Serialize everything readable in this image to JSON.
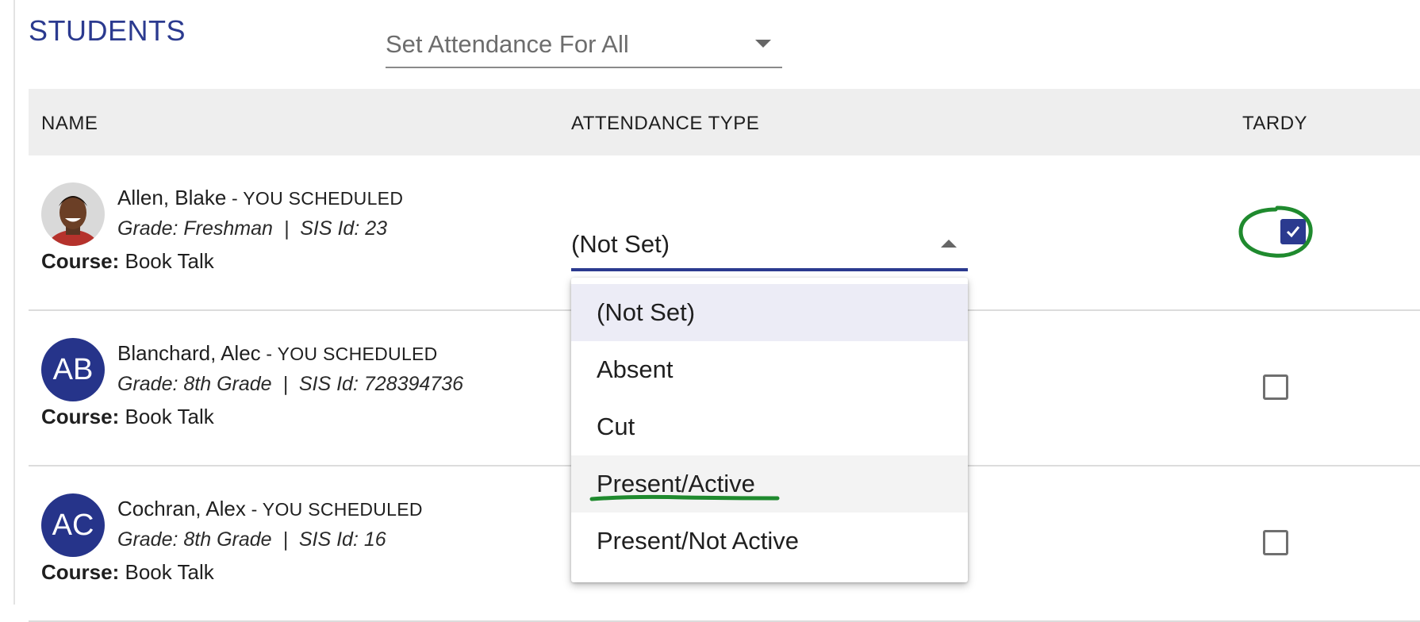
{
  "header": {
    "title": "STUDENTS",
    "set_all_placeholder": "Set Attendance For All"
  },
  "table": {
    "columns": {
      "name": "NAME",
      "attendance": "ATTENDANCE TYPE",
      "tardy": "TARDY"
    },
    "rows": [
      {
        "name": "Allen, Blake",
        "scheduled": " - YOU SCHEDULED",
        "grade": "Grade: Freshman",
        "sis": "SIS Id: 23",
        "separator": "|",
        "course_label": "Course:",
        "course": "Book Talk",
        "avatar": "photo",
        "attendance_value": "(Not Set)",
        "tardy": true
      },
      {
        "name": "Blanchard, Alec",
        "scheduled": " - YOU SCHEDULED",
        "grade": "Grade: 8th Grade",
        "sis": "SIS Id: 728394736",
        "separator": "|",
        "course_label": "Course:",
        "course": "Book Talk",
        "avatar_initials": "AB",
        "tardy": false
      },
      {
        "name": "Cochran, Alex",
        "scheduled": " - YOU SCHEDULED",
        "grade": "Grade: 8th Grade",
        "sis": "SIS Id: 16",
        "separator": "|",
        "course_label": "Course:",
        "course": "Book Talk",
        "avatar_initials": "AC",
        "tardy": false
      }
    ]
  },
  "dropdown": {
    "options": [
      "(Not Set)",
      "Absent",
      "Cut",
      "Present/Active",
      "Present/Not Active"
    ],
    "selected": "(Not Set)",
    "highlighted": "Present/Active"
  },
  "colors": {
    "accent": "#2b3a8f",
    "annotation": "#1f8a2e"
  }
}
